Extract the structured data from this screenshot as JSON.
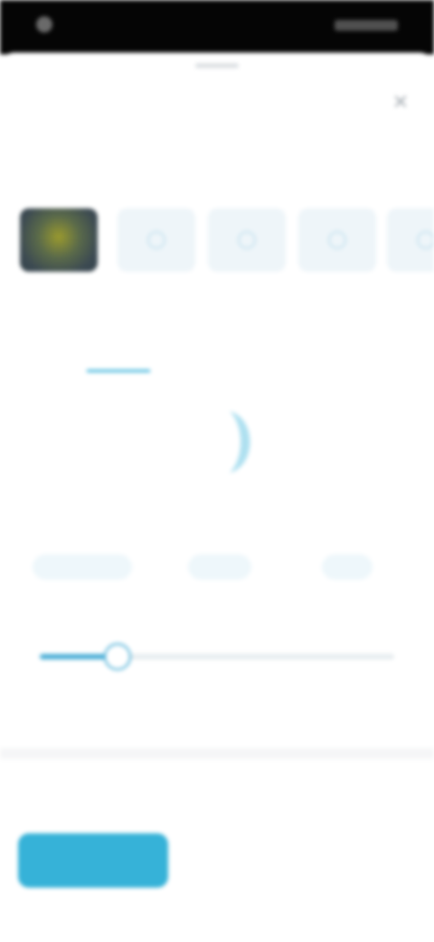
{
  "status_bar": {},
  "sheet": {
    "title": "",
    "close_icon": "close-icon",
    "link_action": ""
  },
  "thumbnails": {
    "caption": ""
  },
  "tabs": [
    {
      "label": ""
    },
    {
      "label": ""
    }
  ],
  "sub_text": "",
  "hero": {
    "icon": "half-moon-icon",
    "label": ""
  },
  "options": [
    {
      "label": ""
    },
    {
      "label": ""
    },
    {
      "label": ""
    }
  ],
  "slider": {
    "value_fraction": 0.22,
    "min_label": "",
    "max_label": ""
  },
  "bottom": {
    "section_label": "",
    "primary_button": "",
    "secondary_links": [
      "",
      ""
    ]
  },
  "colors": {
    "accent": "#36b2d8",
    "accent_light": "#eef7fb",
    "status_bar": "#050505"
  }
}
